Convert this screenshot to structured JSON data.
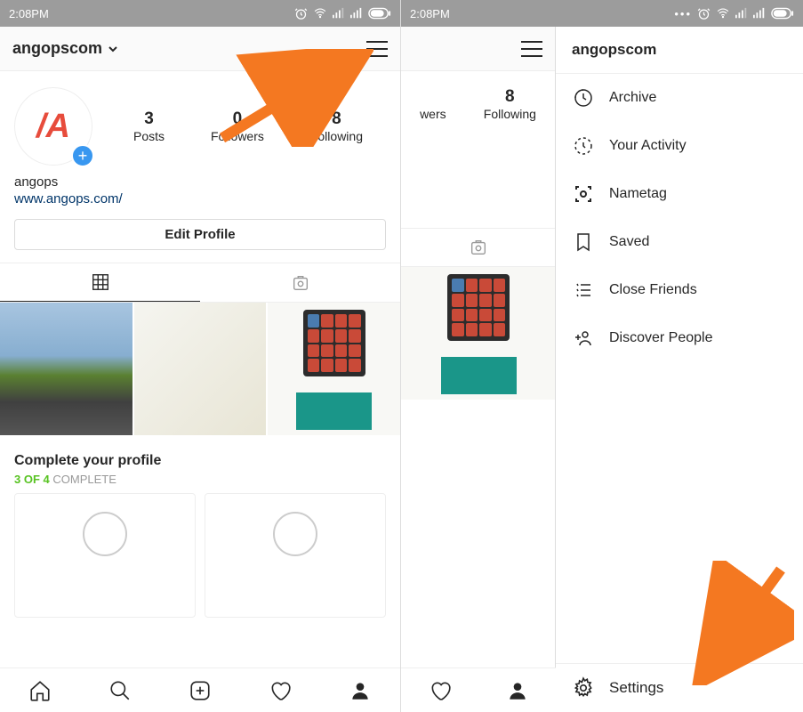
{
  "status": {
    "time": "2:08PM"
  },
  "header": {
    "username": "angopscom"
  },
  "stats": {
    "posts": {
      "num": "3",
      "label": "Posts"
    },
    "followers": {
      "num": "0",
      "label": "Followers"
    },
    "following": {
      "num": "8",
      "label": "Following"
    }
  },
  "bio": {
    "display_name": "angops",
    "website": "www.angops.com/"
  },
  "edit_profile": "Edit Profile",
  "complete": {
    "title": "Complete your profile",
    "progress": "3 OF 4",
    "progress_suffix": " COMPLETE"
  },
  "menu": {
    "username": "angopscom",
    "items": [
      {
        "icon": "archive-icon",
        "label": "Archive"
      },
      {
        "icon": "activity-icon",
        "label": "Your Activity"
      },
      {
        "icon": "nametag-icon",
        "label": "Nametag"
      },
      {
        "icon": "saved-icon",
        "label": "Saved"
      },
      {
        "icon": "close-friends-icon",
        "label": "Close Friends"
      },
      {
        "icon": "discover-icon",
        "label": "Discover People"
      }
    ],
    "settings": "Settings"
  },
  "slice": {
    "wers": "wers",
    "following": "Following",
    "following_num": "8"
  }
}
